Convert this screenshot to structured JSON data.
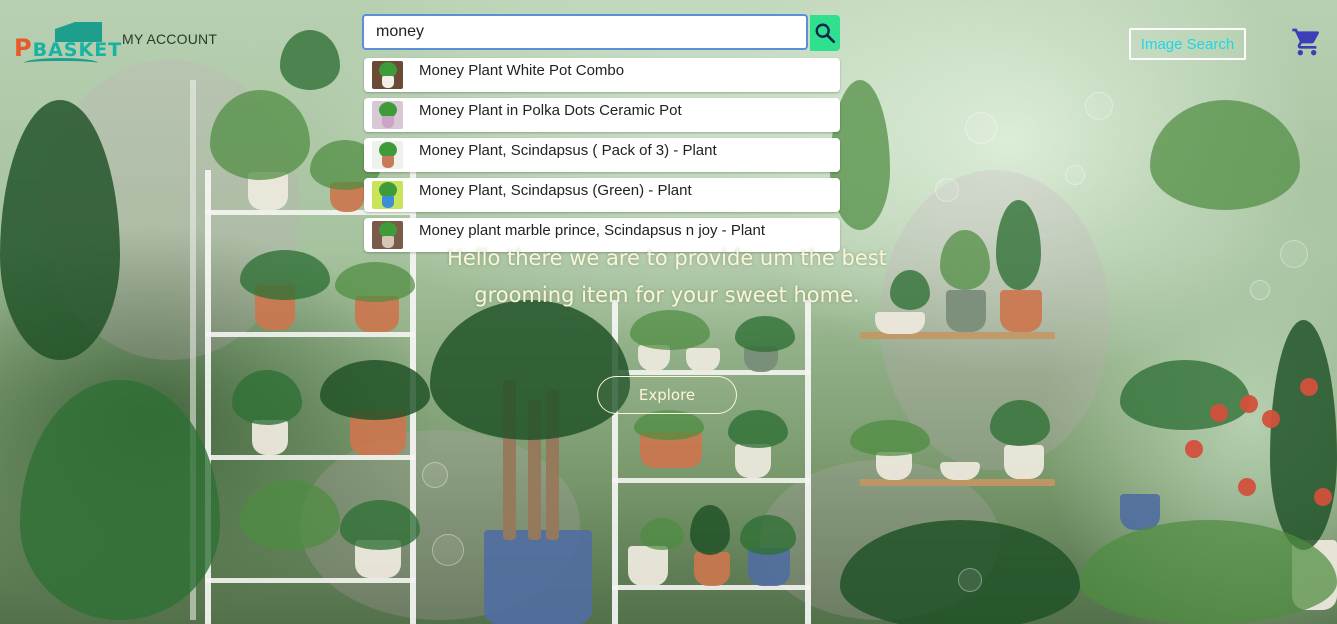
{
  "brand": {
    "logo_text": "PBASKET"
  },
  "nav": {
    "account_label": "MY ACCOUNT"
  },
  "search": {
    "value": "money",
    "button_icon": "search-icon",
    "suggestions": [
      {
        "label": "Money Plant White Pot Combo",
        "thumb_pot_color": "#f2efe6"
      },
      {
        "label": "Money Plant in Polka Dots Ceramic Pot",
        "thumb_pot_color": "#c9a4c6"
      },
      {
        "label": "Money Plant, Scindapsus ( Pack of 3) - Plant",
        "thumb_pot_color": "#c97a5a"
      },
      {
        "label": "Money Plant, Scindapsus (Green) - Plant",
        "thumb_pot_color": "#3b8fd6"
      },
      {
        "label": "Money plant marble prince, Scindapsus n joy - Plant",
        "thumb_pot_color": "#d5c7b8"
      }
    ]
  },
  "header_actions": {
    "image_search_label": "Image Search",
    "cart_icon": "cart-icon"
  },
  "hero": {
    "line1": "Hello there we are to provide um the best",
    "line2": "grooming item for your sweet home.",
    "cta_label": "Explore"
  },
  "colors": {
    "accent_green": "#2fe08e",
    "image_search_text": "#1fd6e6",
    "cart": "#3a3fb5",
    "logo_orange": "#e85a2a",
    "logo_teal": "#17b3a3"
  }
}
